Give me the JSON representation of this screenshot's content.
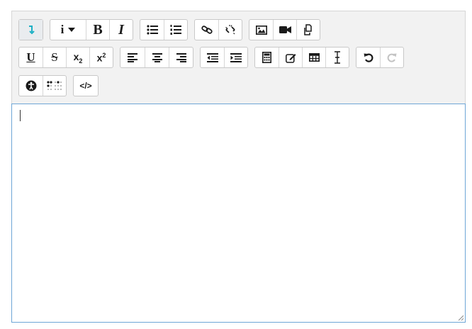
{
  "toolbar": {
    "row1": [
      {
        "group": "toggle",
        "buttons": [
          {
            "name": "show-more-buttons",
            "icon": "arrow-down-icon",
            "color": "#1ab0c5"
          }
        ]
      },
      {
        "group": "style",
        "buttons": [
          {
            "name": "paragraph-styles",
            "label": "i",
            "icon": "caret-down-icon"
          },
          {
            "name": "bold",
            "label": "B"
          },
          {
            "name": "italic",
            "label": "I"
          }
        ]
      },
      {
        "group": "lists",
        "buttons": [
          {
            "name": "unordered-list",
            "icon": "list-ul-icon"
          },
          {
            "name": "ordered-list",
            "icon": "list-ol-icon"
          }
        ]
      },
      {
        "group": "links",
        "buttons": [
          {
            "name": "link",
            "icon": "link-icon"
          },
          {
            "name": "unlink",
            "icon": "unlink-icon"
          }
        ]
      },
      {
        "group": "files",
        "buttons": [
          {
            "name": "image",
            "icon": "image-icon"
          },
          {
            "name": "media",
            "icon": "video-icon"
          },
          {
            "name": "manage-files",
            "icon": "files-icon"
          }
        ]
      }
    ],
    "row2": [
      {
        "group": "text",
        "buttons": [
          {
            "name": "underline",
            "label": "U"
          },
          {
            "name": "strikethrough",
            "label": "S"
          },
          {
            "name": "subscript",
            "label": "x",
            "sub": "2"
          },
          {
            "name": "superscript",
            "label": "x",
            "sup": "2"
          }
        ]
      },
      {
        "group": "align",
        "buttons": [
          {
            "name": "align-left",
            "icon": "align-left-icon"
          },
          {
            "name": "align-center",
            "icon": "align-center-icon"
          },
          {
            "name": "align-right",
            "icon": "align-right-icon"
          }
        ]
      },
      {
        "group": "indent",
        "buttons": [
          {
            "name": "outdent",
            "icon": "outdent-icon"
          },
          {
            "name": "indent",
            "icon": "indent-icon"
          }
        ]
      },
      {
        "group": "insert",
        "buttons": [
          {
            "name": "equation",
            "icon": "calculator-icon"
          },
          {
            "name": "special-character",
            "icon": "pencil-square-icon"
          },
          {
            "name": "table",
            "icon": "table-icon"
          },
          {
            "name": "clear-formatting",
            "icon": "text-cursor-icon"
          }
        ]
      },
      {
        "group": "undo",
        "buttons": [
          {
            "name": "undo",
            "icon": "undo-icon"
          },
          {
            "name": "redo",
            "icon": "redo-icon",
            "disabled": true
          }
        ]
      }
    ],
    "row3": [
      {
        "group": "accessibility",
        "buttons": [
          {
            "name": "accessibility-checker",
            "icon": "universal-access-icon"
          },
          {
            "name": "screenreader-helper",
            "icon": "braille-icon"
          }
        ]
      },
      {
        "group": "html",
        "buttons": [
          {
            "name": "html",
            "label": "</>",
            "icon": "code-icon"
          }
        ]
      }
    ]
  },
  "content": {
    "text": ""
  },
  "colors": {
    "accent": "#1ab0c5",
    "toolbar_bg": "#f2f2f2",
    "focus_border": "#6ea6d6"
  }
}
